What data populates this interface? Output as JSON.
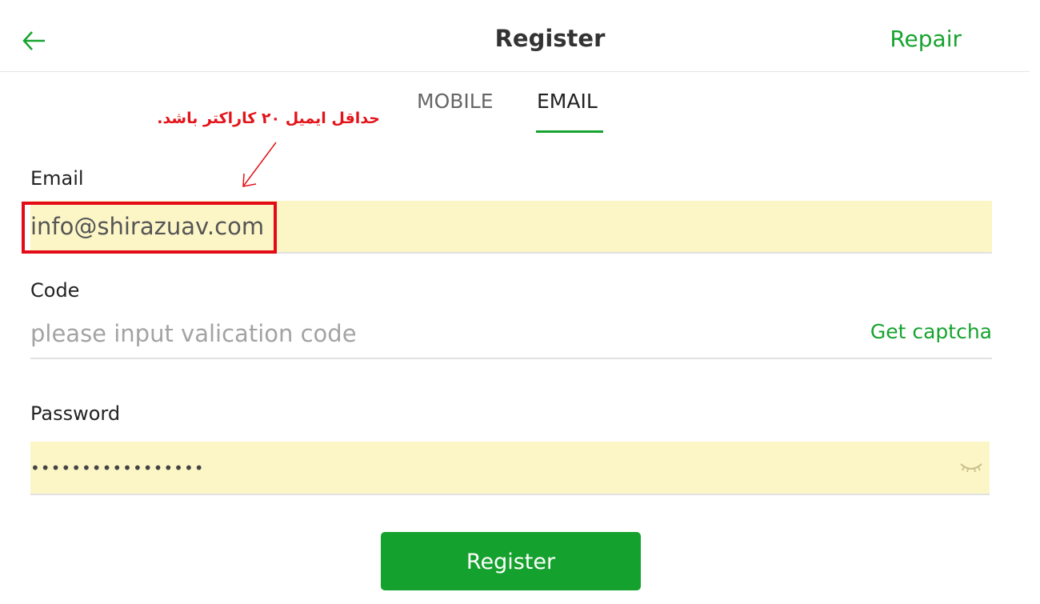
{
  "header": {
    "back_icon": "arrow-left-icon",
    "title": "Register",
    "repair_label": "Repair"
  },
  "tabs": [
    {
      "label": "MOBILE",
      "active": false
    },
    {
      "label": "EMAIL",
      "active": true
    }
  ],
  "annotation": {
    "text": "حداقل ایمیل ۲۰ کاراکتر باشد.",
    "color": "#e2141a"
  },
  "form": {
    "email": {
      "label": "Email",
      "value": "info@shirazuav.com"
    },
    "code": {
      "label": "Code",
      "placeholder": "please input valication code",
      "captcha_label": "Get captcha"
    },
    "password": {
      "label": "Password",
      "masked_value": "•••••••••••••••••",
      "toggle_icon": "eye-closed-icon"
    }
  },
  "register_button": {
    "label": "Register"
  },
  "colors": {
    "accent": "#17a32f",
    "autofill_bg": "#fcf6c7",
    "highlight": "#e40b18"
  }
}
